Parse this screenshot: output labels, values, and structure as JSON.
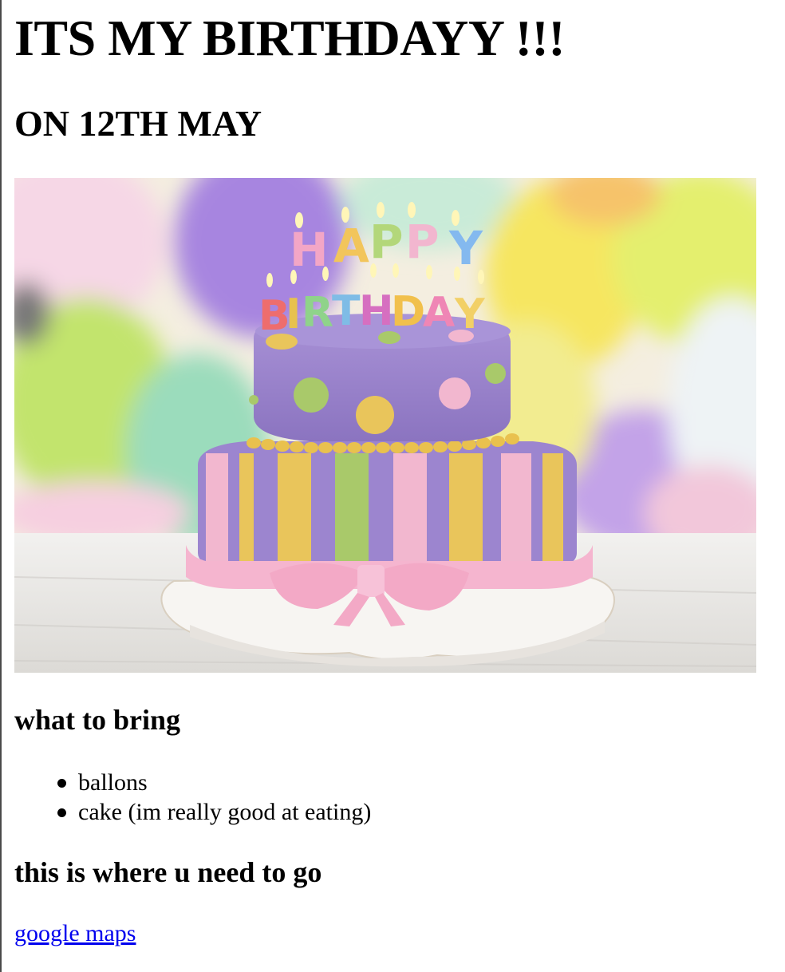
{
  "header": {
    "title": "ITS MY BIRTHDAYY !!!",
    "subtitle": "ON 12TH MAY"
  },
  "hero_image": {
    "alt": "",
    "candle_letters_top": "HAPPY",
    "candle_letters_bottom": "BIRTHDAY",
    "colors": {
      "purple": "#9f86cf",
      "green": "#a9c96a",
      "yellow": "#e8c45a",
      "pink": "#f3b6cf",
      "plate": "#f7f5f2"
    }
  },
  "bring_section": {
    "heading": "what to bring",
    "items": [
      "ballons",
      "cake (im really good at eating)"
    ]
  },
  "location_section": {
    "heading": "this is where u need to go",
    "link_text": "google maps"
  }
}
